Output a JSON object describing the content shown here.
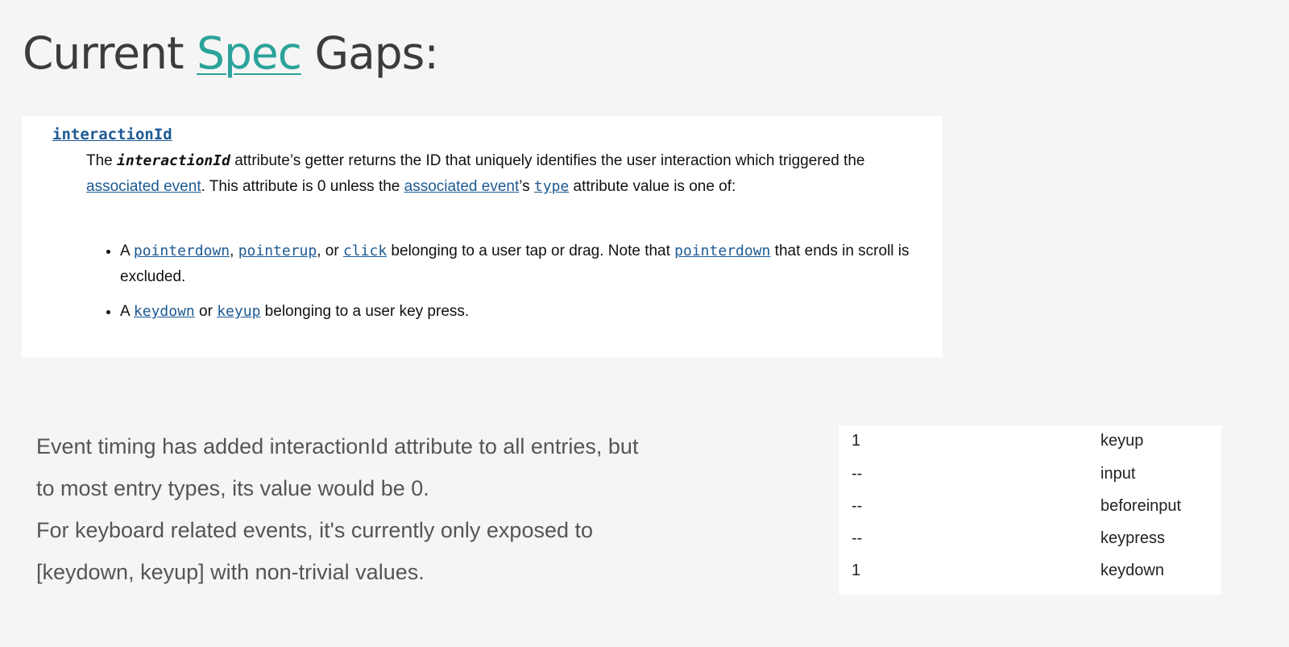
{
  "title": {
    "before": "Current ",
    "link": "Spec",
    "after": " Gaps:"
  },
  "spec": {
    "term": "interactionId",
    "def": {
      "p1": "The ",
      "em": "interactionId",
      "p2": " attribute’s getter returns the ID that uniquely identifies the user interaction which triggered the ",
      "link1": "associated event",
      "p3": ". This attribute is 0 unless the ",
      "link2": "associated event",
      "p4": "’s ",
      "link3": "type",
      "p5": " attribute value is one of:"
    },
    "bullets": [
      {
        "pre": "A ",
        "code1": "pointerdown",
        "sep1": ", ",
        "code2": "pointerup",
        "sep2": ", or ",
        "code3": "click",
        "mid": " belonging to a user tap or drag. Note that ",
        "code4": "pointerdown",
        "post": " that ends in scroll is excluded."
      },
      {
        "pre": "A ",
        "code1": "keydown",
        "sep1": " or ",
        "code2": "keyup",
        "post": " belonging to a user key press."
      }
    ]
  },
  "body": {
    "line1": "Event timing has added interactionId attribute to all entries, but",
    "line2": "to most entry types, its value would be 0.",
    "line3": "For keyboard related events, it's currently only exposed to",
    "line4": "[keydown, keyup] with non-trivial values."
  },
  "events_table": [
    {
      "id": "1",
      "type": "keyup"
    },
    {
      "id": "--",
      "type": "input"
    },
    {
      "id": "--",
      "type": "beforeinput"
    },
    {
      "id": "--",
      "type": "keypress"
    },
    {
      "id": "1",
      "type": "keydown"
    }
  ],
  "colors": {
    "title_text": "#3c3c3c",
    "title_link": "#2ba39a",
    "spec_link": "#1d5a93",
    "body_text": "#555555",
    "background": "#f5f5f5"
  }
}
